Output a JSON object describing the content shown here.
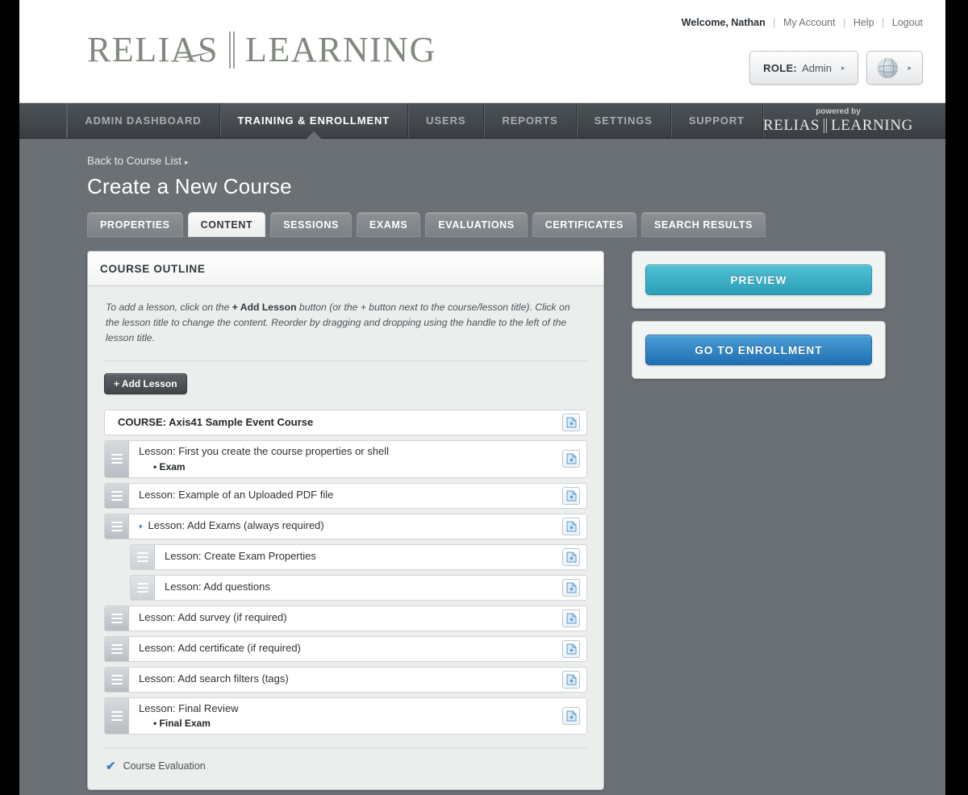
{
  "header": {
    "welcome": "Welcome, Nathan",
    "links": [
      "My Account",
      "Help",
      "Logout"
    ],
    "logo_left": "RELIAS",
    "logo_right": "LEARNING",
    "role_label": "ROLE:",
    "role_value": "Admin",
    "role_caret": "▸",
    "globe_caret": "▸"
  },
  "nav": {
    "items": [
      {
        "label": "ADMIN DASHBOARD",
        "active": false
      },
      {
        "label": "TRAINING & ENROLLMENT",
        "active": true
      },
      {
        "label": "USERS",
        "active": false
      },
      {
        "label": "REPORTS",
        "active": false
      },
      {
        "label": "SETTINGS",
        "active": false
      },
      {
        "label": "SUPPORT",
        "active": false
      }
    ],
    "powered_by": "powered by",
    "brand_left": "RELIAS",
    "brand_right": "LEARNING"
  },
  "page": {
    "breadcrumb": "Back to Course List",
    "breadcrumb_caret": "▸",
    "title": "Create a New Course"
  },
  "subtabs": [
    {
      "label": "PROPERTIES",
      "active": false
    },
    {
      "label": "CONTENT",
      "active": true
    },
    {
      "label": "SESSIONS",
      "active": false
    },
    {
      "label": "EXAMS",
      "active": false
    },
    {
      "label": "EVALUATIONS",
      "active": false
    },
    {
      "label": "CERTIFICATES",
      "active": false
    },
    {
      "label": "SEARCH RESULTS",
      "active": false
    }
  ],
  "outline": {
    "panel_title": "COURSE OUTLINE",
    "hint_part1": "To add a lesson, click on the ",
    "hint_bold": "+ Add Lesson",
    "hint_part2": " button (or the + button next to the course/lesson title). Click on the lesson title to change the content. Reorder by dragging and dropping using the handle to the left of the lesson title.",
    "add_lesson_label": "+ Add Lesson",
    "course_row": "COURSE: Axis41 Sample Event Course",
    "rows": [
      {
        "title": "Lesson: First you create the course properties or shell",
        "sub": "• Exam",
        "nested": false,
        "caret": ""
      },
      {
        "title": "Lesson: Example of an Uploaded PDF file",
        "sub": "",
        "nested": false,
        "caret": ""
      },
      {
        "title": "Lesson: Add Exams (always required)",
        "sub": "",
        "nested": false,
        "caret": "▾"
      },
      {
        "title": "Lesson: Create Exam Properties",
        "sub": "",
        "nested": true,
        "caret": ""
      },
      {
        "title": "Lesson: Add questions",
        "sub": "",
        "nested": true,
        "caret": ""
      },
      {
        "title": "Lesson: Add survey (if required)",
        "sub": "",
        "nested": false,
        "caret": ""
      },
      {
        "title": "Lesson: Add certificate (if required)",
        "sub": "",
        "nested": false,
        "caret": ""
      },
      {
        "title": "Lesson: Add search filters (tags)",
        "sub": "",
        "nested": false,
        "caret": ""
      },
      {
        "title": "Lesson: Final Review",
        "sub": "• Final Exam",
        "nested": false,
        "caret": ""
      }
    ],
    "evaluation_label": "Course Evaluation",
    "evaluation_check": "✔"
  },
  "side": {
    "preview_label": "PREVIEW",
    "enroll_label": "GO TO ENROLLMENT"
  },
  "colors": {
    "page_bg": "#6b7074",
    "nav_dark": "#41464a",
    "logo_gray": "#82897f",
    "preview_teal": "#2c9fb8",
    "enroll_blue": "#1f6fb4",
    "icon_blue": "#4a90c8",
    "check_blue": "#3f7fbf"
  }
}
